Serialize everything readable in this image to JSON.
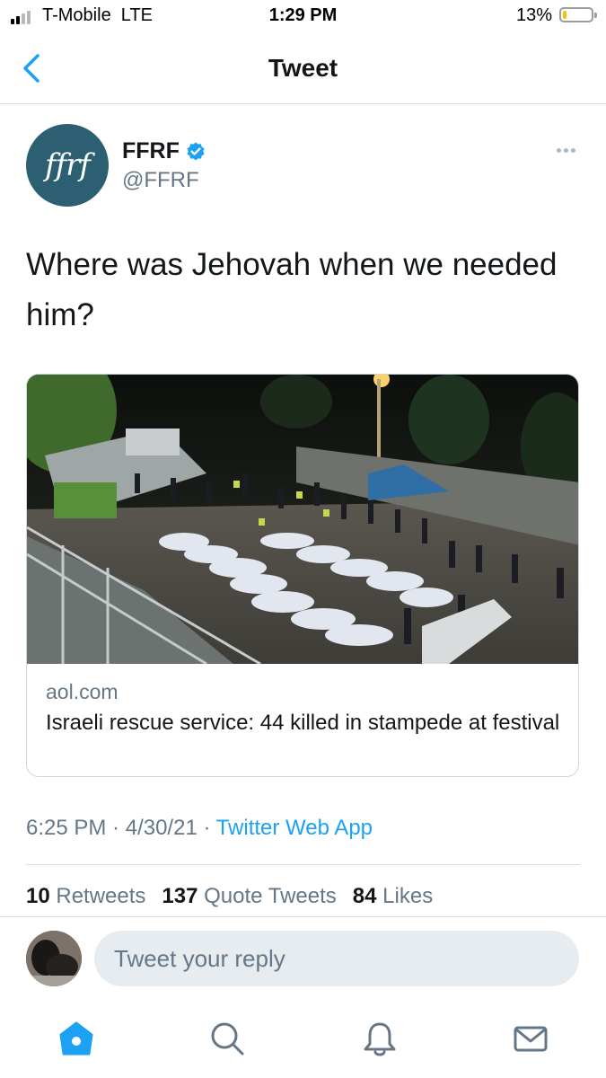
{
  "status_bar": {
    "carrier": "T-Mobile  LTE",
    "time": "1:29 PM",
    "battery_percent": "13%",
    "battery_level": 0.13,
    "signal_bars": 2
  },
  "nav": {
    "title": "Tweet",
    "back_icon": "chevron-left-icon"
  },
  "tweet": {
    "avatar_text": "ffrf",
    "author_name": "FFRF",
    "verified": true,
    "handle": "@FFRF",
    "text": "Where was Jehovah when we needed him?",
    "card": {
      "domain": "aol.com",
      "title": "Israeli rescue service: 44 killed in stampede at festival"
    },
    "time": "6:25 PM",
    "date": "4/30/21",
    "separator": " · ",
    "source": "Twitter Web App"
  },
  "stats": [
    {
      "count": "10",
      "label": "Retweets"
    },
    {
      "count": "137",
      "label": "Quote Tweets"
    },
    {
      "count": "84",
      "label": "Likes"
    }
  ],
  "reply": {
    "placeholder": "Tweet your reply"
  },
  "tabs": [
    {
      "icon": "home-icon",
      "active": true
    },
    {
      "icon": "search-icon",
      "active": false
    },
    {
      "icon": "bell-icon",
      "active": false
    },
    {
      "icon": "mail-icon",
      "active": false
    }
  ],
  "colors": {
    "accent": "#1da1f2",
    "secondary_text": "#657786",
    "avatar_bg": "#2c5f72",
    "battery_low": "#f5c400"
  }
}
